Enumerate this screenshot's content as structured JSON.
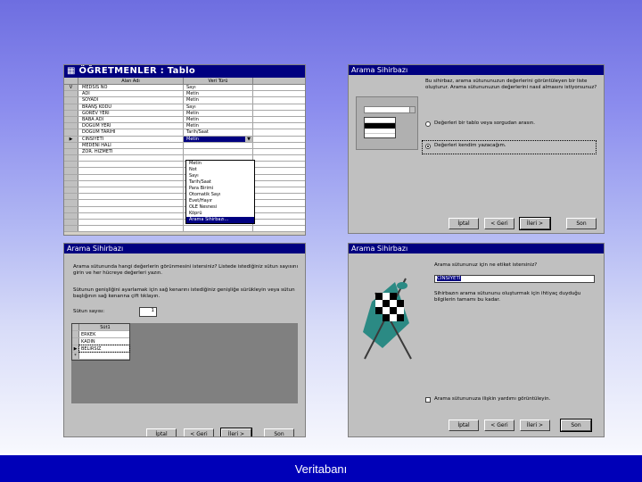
{
  "footer": {
    "text": "Veritabanı"
  },
  "table_window": {
    "title": "ÖĞRETMENLER : Tablo",
    "columns": [
      "Alan Adı",
      "Veri Türü",
      ""
    ],
    "rows": [
      {
        "marker": "V",
        "name": "MEDSIS NO",
        "type": "Sayı"
      },
      {
        "marker": "",
        "name": "ADI",
        "type": "Metin"
      },
      {
        "marker": "",
        "name": "SOYADI",
        "type": "Metin"
      },
      {
        "marker": "",
        "name": "BRANŞ KODU",
        "type": "Sayı"
      },
      {
        "marker": "",
        "name": "GOREV YERI",
        "type": "Metin"
      },
      {
        "marker": "",
        "name": "BABA ADI",
        "type": "Metin"
      },
      {
        "marker": "",
        "name": "DOĞUM YERI",
        "type": "Metin"
      },
      {
        "marker": "",
        "name": "DOĞUM TARİHİ",
        "type": "Tarih/Saat"
      },
      {
        "marker": "▶",
        "name": "CİNSİYETİ",
        "type": "Metin"
      },
      {
        "marker": "",
        "name": "MEDENİ HALİ",
        "type": ""
      },
      {
        "marker": "",
        "name": "ZOR. HİZMETİ",
        "type": ""
      },
      {
        "marker": "",
        "name": "",
        "type": ""
      },
      {
        "marker": "",
        "name": "",
        "type": ""
      },
      {
        "marker": "",
        "name": "",
        "type": ""
      },
      {
        "marker": "",
        "name": "",
        "type": ""
      },
      {
        "marker": "",
        "name": "",
        "type": ""
      },
      {
        "marker": "",
        "name": "",
        "type": ""
      },
      {
        "marker": "",
        "name": "",
        "type": ""
      },
      {
        "marker": "",
        "name": "",
        "type": ""
      },
      {
        "marker": "",
        "name": "",
        "type": ""
      },
      {
        "marker": "",
        "name": "",
        "type": ""
      },
      {
        "marker": "",
        "name": "",
        "type": ""
      },
      {
        "marker": "",
        "name": "",
        "type": ""
      }
    ],
    "type_list": [
      "Metin",
      "Not",
      "Sayı",
      "Tarih/Saat",
      "Para Birimi",
      "Otomatik Sayı",
      "Evet/Hayır",
      "OLE Nesnesi",
      "Köprü",
      "Arama Sihirbazı..."
    ],
    "type_list_selected": 9
  },
  "wizard1": {
    "title": "Arama Sihirbazı",
    "description": "Bu sihirbaz, arama sütununuzun değerlerini görüntüleyen bir liste oluşturur. Arama sütununuzun değerlerini nasıl almasını istiyorsunuz?",
    "option1": "Değerleri bir tablo veya sorgudan arasın.",
    "option2": "Değerleri kendim yazacağım.",
    "buttons": [
      "İptal",
      "< Geri",
      "İleri >",
      "Son"
    ]
  },
  "wizard2": {
    "title": "Arama Sihirbazı",
    "description": "Arama sütununda hangi değerlerin görünmesini istersiniz? Listede istediğiniz sütun sayısını girin ve her hücreye değerleri yazın.",
    "hint": "Sütunun genişliğini ayarlamak için sağ kenarını istediğiniz genişliğe sürükleyin veya sütun başlığının sağ kenarına çift tıklayın.",
    "column_count_label": "Sütun sayısı:",
    "column_count_value": "1",
    "grid_header": "Süt1",
    "grid_values": [
      "ERKEK",
      "KADIN",
      "BELIRSIZ",
      ""
    ],
    "grid_markers": [
      "",
      "",
      "▶",
      "*"
    ],
    "buttons": [
      "İptal",
      "< Geri",
      "İleri >",
      "Son"
    ]
  },
  "wizard3": {
    "title": "Arama Sihirbazı",
    "label_prompt": "Arama sütununuz için ne etiket istersiniz?",
    "label_value": "CİNSİYETİ",
    "info": "Sihirbazın arama sütununu oluşturmak için ihtiyaç duyduğu bilgilerin tamamı bu kadar.",
    "checkbox_label": "Arama sütununuza ilişkin yardımı görüntüleyin.",
    "buttons": [
      "İptal",
      "< Geri",
      "İleri >",
      "Son"
    ]
  },
  "colors": {
    "titlebar": "#000080",
    "dialog": "#c0c0c0",
    "footer": "#0000b8"
  }
}
